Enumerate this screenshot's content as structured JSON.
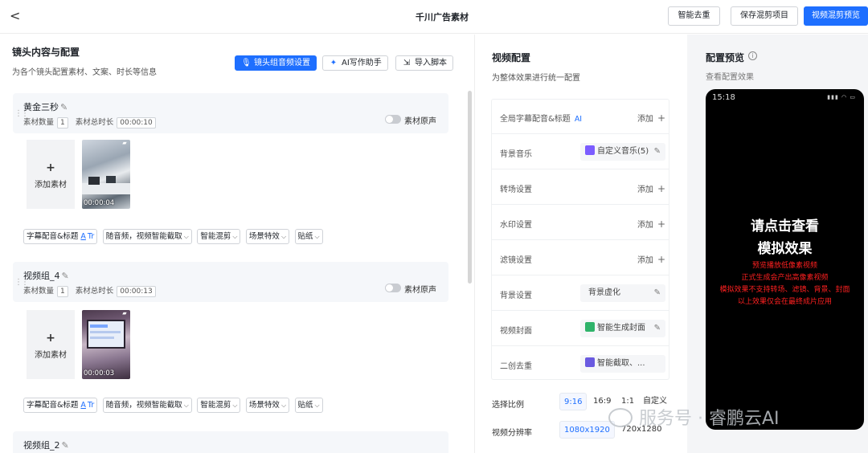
{
  "topbar": {
    "back": "<",
    "title": "千川广告素材",
    "buttons": [
      "智能去重",
      "保存混剪项目",
      "视频混剪预览"
    ]
  },
  "left": {
    "title": "镜头内容与配置",
    "subtitle": "为各个镜头配置素材、文案、时长等信息",
    "actions": [
      "镜头组音频设置",
      "AI写作助手",
      "导入脚本"
    ],
    "groups": [
      {
        "name": "黄金三秒",
        "count_label": "素材数量",
        "count": "1",
        "duration_label": "素材总时长",
        "duration": "00:00:10",
        "original_sound": "素材原声",
        "add_label": "添加素材",
        "thumb_duration": "00:00:04",
        "options": [
          "字幕配音&标题",
          "随音频，视频智能截取",
          "智能混剪",
          "场景特效",
          "贴纸"
        ]
      },
      {
        "name": "视频组_4",
        "count_label": "素材数量",
        "count": "1",
        "duration_label": "素材总时长",
        "duration": "00:00:13",
        "original_sound": "素材原声",
        "add_label": "添加素材",
        "thumb_duration": "00:00:03",
        "options": [
          "字幕配音&标题",
          "随音频，视频智能截取",
          "智能混剪",
          "场景特效",
          "贴纸"
        ]
      },
      {
        "name": "视频组_2"
      }
    ]
  },
  "mid": {
    "title": "视频配置",
    "subtitle": "为整体效果进行统一配置",
    "rows": [
      {
        "label": "全局字幕配音&标题",
        "ai": "AI",
        "action": "添加"
      },
      {
        "label": "背景音乐",
        "value": "自定义音乐(5)"
      },
      {
        "label": "转场设置",
        "action": "添加"
      },
      {
        "label": "水印设置",
        "action": "添加"
      },
      {
        "label": "滤镜设置",
        "action": "添加"
      },
      {
        "label": "背景设置",
        "value": "背景虚化"
      },
      {
        "label": "视频封面",
        "value": "智能生成封面"
      },
      {
        "label": "二创去重",
        "value": "智能截取、..."
      }
    ],
    "ratio_label": "选择比例",
    "ratios": [
      "9:16",
      "16:9",
      "1:1",
      "自定义"
    ],
    "resolution_label": "视频分辨率",
    "resolutions": [
      "1080x1920",
      "720x1280"
    ]
  },
  "right": {
    "title": "配置预览",
    "subtitle": "查看配置效果",
    "phone_time": "15:18",
    "main_line1": "请点击查看",
    "main_line2": "模拟效果",
    "notes": [
      "预览播放低像素视频",
      "正式生成会产出高像素视频",
      "模拟效果不支持转场、滤镜、背景、封面",
      "以上效果仅会在最终成片应用"
    ]
  },
  "watermark": "服务号 · 睿鹏云AI",
  "colors": {
    "accent": "#1e6fff",
    "warning": "#ff2020"
  }
}
